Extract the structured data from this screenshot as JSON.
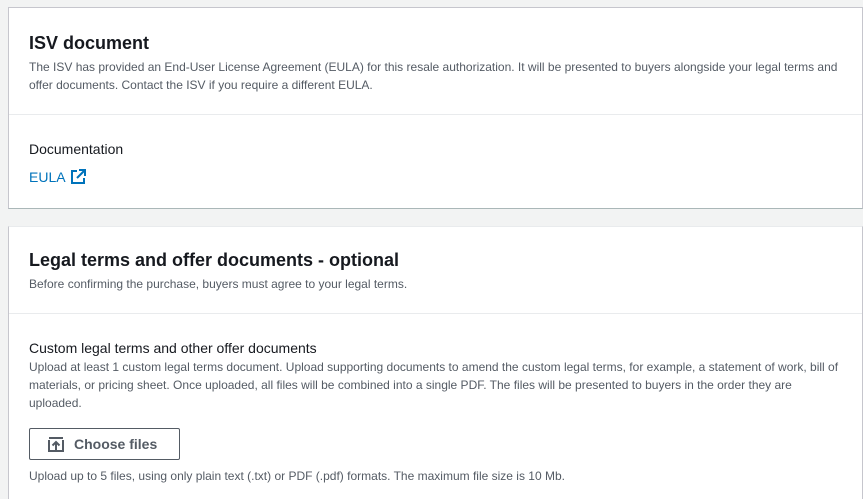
{
  "isv_section": {
    "title": "ISV document",
    "description": "The ISV has provided an End-User License Agreement (EULA) for this resale authorization. It will be presented to buyers alongside your legal terms and offer documents. Contact the ISV if you require a different EULA.",
    "documentation_label": "Documentation",
    "eula_link": "EULA"
  },
  "legal_section": {
    "title": "Legal terms and offer documents - optional",
    "description": "Before confirming the purchase, buyers must agree to your legal terms.",
    "custom_label": "Custom legal terms and other offer documents",
    "custom_description": "Upload at least 1 custom legal terms document. Upload supporting documents to amend the custom legal terms, for example, a statement of work, bill of materials, or pricing sheet. Once uploaded, all files will be combined into a single PDF. The files will be presented to buyers in the order they are uploaded.",
    "choose_files_label": "Choose files",
    "constraint_text": "Upload up to 5 files, using only plain text (.txt) or PDF (.pdf) formats. The maximum file size is 10 Mb."
  },
  "colors": {
    "link": "#0073bb",
    "text": "#16191f",
    "secondary_text": "#545b64",
    "background": "#f2f3f3"
  },
  "icons": {
    "external_link": "external-link-icon",
    "upload": "upload-icon"
  }
}
